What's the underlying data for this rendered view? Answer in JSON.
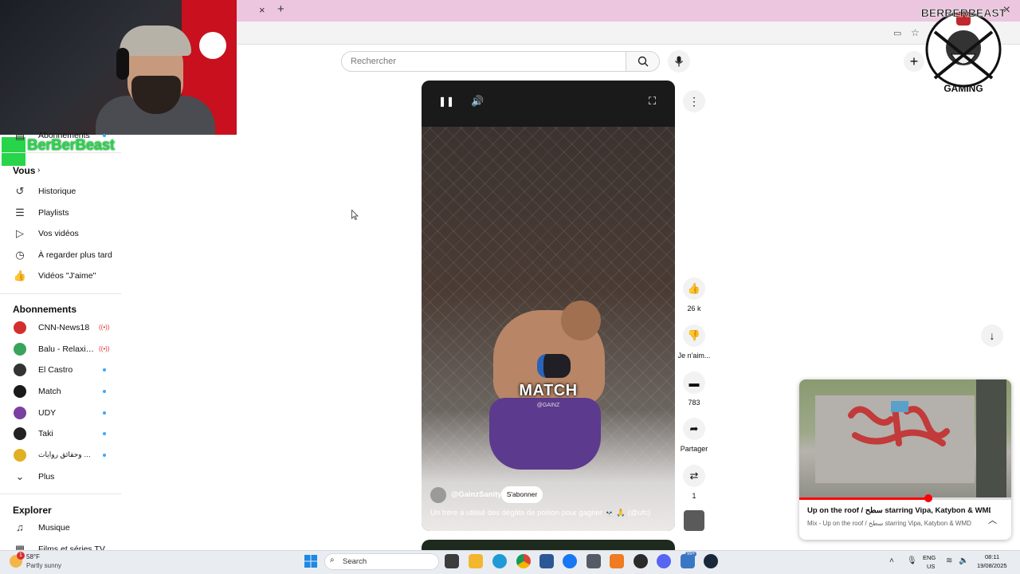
{
  "tabs": {
    "new_tab": "+",
    "close_tab": "×",
    "window_close": "×"
  },
  "overlay": {
    "streamer_name": "BerBerBeast",
    "logo_text_top": "BERBERBEAST",
    "logo_text_bottom": "GAMING"
  },
  "search": {
    "placeholder": "Rechercher"
  },
  "sidebar": {
    "subscriptions_top": "Abonnements",
    "you_header": "Vous",
    "you_items": [
      {
        "label": "Historique",
        "icon": "history-icon"
      },
      {
        "label": "Playlists",
        "icon": "playlists-icon"
      },
      {
        "label": "Vos vidéos",
        "icon": "your-videos-icon"
      },
      {
        "label": "À regarder plus tard",
        "icon": "watch-later-icon"
      },
      {
        "label": "Vidéos \"J'aime\"",
        "icon": "thumb-up-icon"
      }
    ],
    "subscriptions_header": "Abonnements",
    "subscriptions": [
      {
        "label": "CNN-News18",
        "color": "#d32f2f",
        "status": "live"
      },
      {
        "label": "Balu - Relaxing N...",
        "color": "#3aa35a",
        "status": "live"
      },
      {
        "label": "El Castro",
        "color": "#333333",
        "status": "new"
      },
      {
        "label": "Match",
        "color": "#1a1a1a",
        "status": "new"
      },
      {
        "label": "UDY",
        "color": "#7a3fa0",
        "status": "new"
      },
      {
        "label": "Taki",
        "color": "#222222",
        "status": "new"
      },
      {
        "label": "أحداث وحقائق روايات ...",
        "color": "#e0b020",
        "status": "new"
      }
    ],
    "more_label": "Plus",
    "explore_header": "Explorer",
    "explore_items": [
      {
        "label": "Musique",
        "icon": "music-icon"
      },
      {
        "label": "Films et séries TV",
        "icon": "film-icon"
      }
    ]
  },
  "short": {
    "overlay_text": "MATCH",
    "overlay_sub": "@GAINZ",
    "channel": "@GainzSanity",
    "subscribe_label": "S'abonner",
    "title": "Un frère a utilisé des dégâts de poison pour gagner 💀 🙏 (@ufc)"
  },
  "actions": {
    "likes": "26 k",
    "dislike_label": "Je n'aim...",
    "comments": "783",
    "share_label": "Partager",
    "remix_count": "1"
  },
  "miniplayer": {
    "title": "Up on the roof / سطح starring Vipa, Katybon & WMD",
    "subtitle": "Mix - Up on the roof / سطح starring Vipa, Katybon & WMD",
    "progress": 0.61
  },
  "taskbar": {
    "weather_temp": "58°F",
    "weather_desc": "Partly sunny",
    "weather_badge": "1",
    "search_label": "Search",
    "lang_1": "ENG",
    "lang_2": "US",
    "time": "08:11",
    "date": "19/08/2025",
    "notification_badge": "99+"
  }
}
